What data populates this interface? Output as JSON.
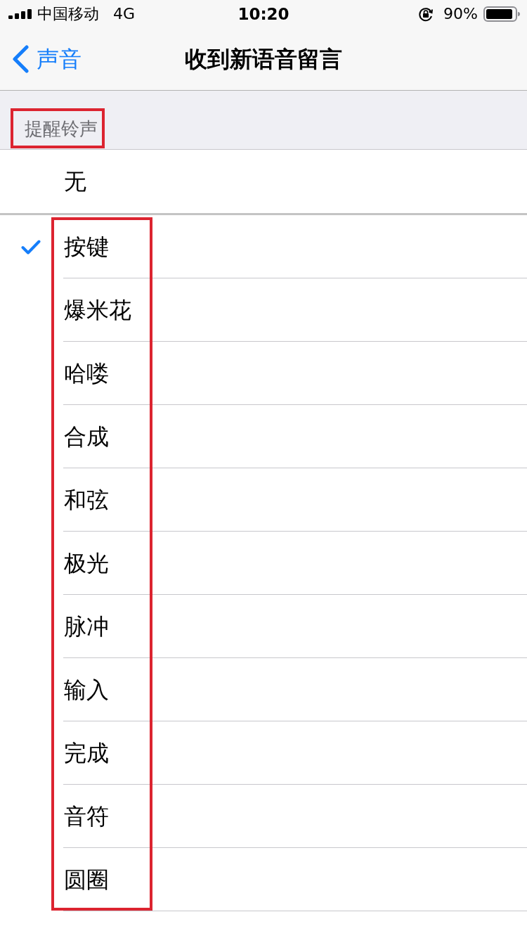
{
  "status_bar": {
    "carrier": "中国移动",
    "network": "4G",
    "time": "10:20",
    "battery": "90%"
  },
  "nav": {
    "back": "声音",
    "title": "收到新语音留言"
  },
  "section": {
    "header": "提醒铃声",
    "highlighted": true
  },
  "tone_groups": [
    {
      "highlighted": false,
      "items": [
        {
          "label": "无",
          "selected": false
        }
      ]
    },
    {
      "highlighted": true,
      "items": [
        {
          "label": "按键",
          "selected": true
        },
        {
          "label": "爆米花",
          "selected": false
        },
        {
          "label": "哈喽",
          "selected": false
        },
        {
          "label": "合成",
          "selected": false
        },
        {
          "label": "和弦",
          "selected": false
        },
        {
          "label": "极光",
          "selected": false
        },
        {
          "label": "脉冲",
          "selected": false
        },
        {
          "label": "输入",
          "selected": false
        },
        {
          "label": "完成",
          "selected": false
        },
        {
          "label": "音符",
          "selected": false
        },
        {
          "label": "圆圈",
          "selected": false
        }
      ]
    }
  ]
}
